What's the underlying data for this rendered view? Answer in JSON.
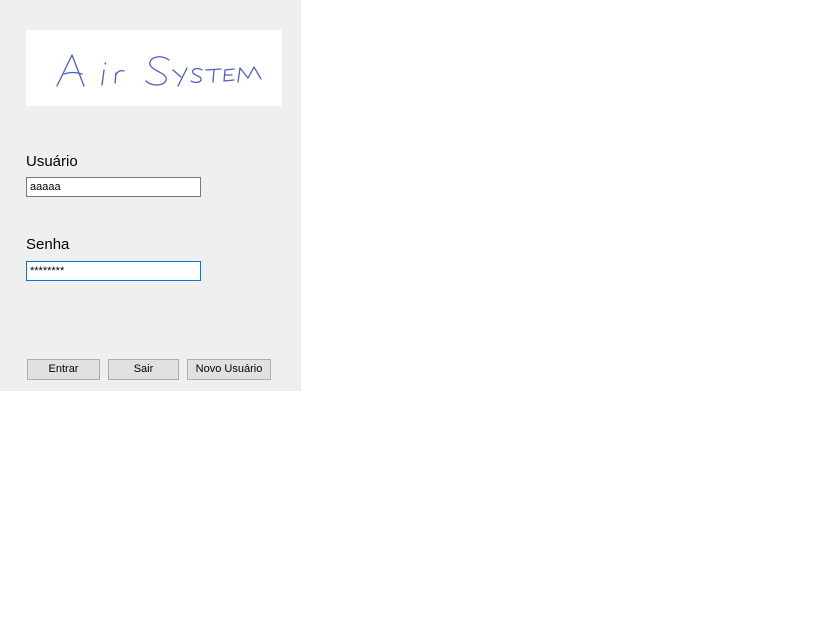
{
  "logo": {
    "text": "Air System"
  },
  "login": {
    "username_label": "Usuário",
    "username_value": "aaaaa",
    "password_label": "Senha",
    "password_value": "********"
  },
  "buttons": {
    "enter_label": "Entrar",
    "exit_label": "Sair",
    "new_user_label": "Novo Usuário"
  },
  "colors": {
    "panel_background": "#efefef",
    "logo_ink": "#4a5ec8",
    "focus_border": "#0078d7",
    "button_face": "#e1e1e1"
  }
}
